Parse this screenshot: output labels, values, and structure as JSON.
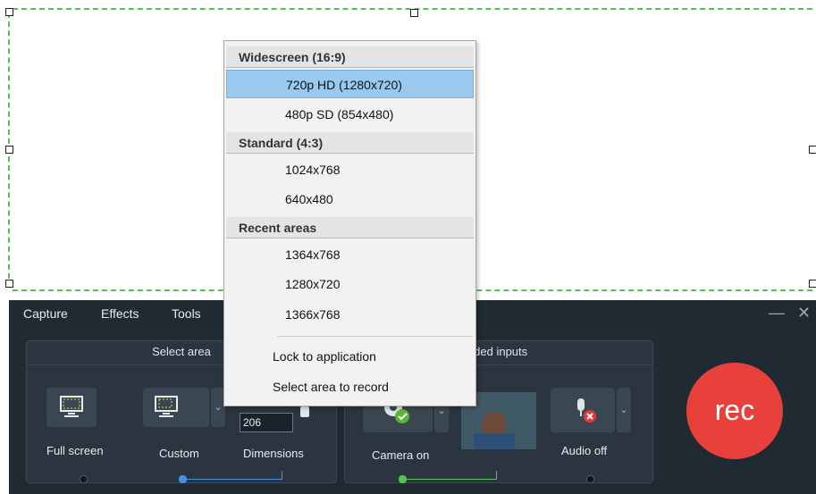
{
  "menu": [
    "Capture",
    "Effects",
    "Tools"
  ],
  "window_controls": {
    "minimize": "—",
    "close": "✕"
  },
  "select_area": {
    "title": "Select area",
    "full_screen": "Full screen",
    "custom": "Custom",
    "dimensions": "Dimensions",
    "height_value": "206"
  },
  "recorded_inputs": {
    "title": "rded inputs",
    "camera": "Camera on",
    "audio": "Audio off"
  },
  "rec_label": "rec",
  "dropdown": {
    "widescreen_header": "Widescreen (16:9)",
    "widescreen": [
      "720p HD (1280x720)",
      "480p SD (854x480)"
    ],
    "standard_header": "Standard (4:3)",
    "standard": [
      "1024x768",
      "640x480"
    ],
    "recent_header": "Recent areas",
    "recent": [
      "1364x768",
      "1280x720",
      "1366x768"
    ],
    "lock": "Lock to application",
    "select_record": "Select area to record"
  },
  "colors": {
    "selection_border": "#55c155",
    "rec": "#e8413c",
    "highlight": "#99c9ef"
  }
}
